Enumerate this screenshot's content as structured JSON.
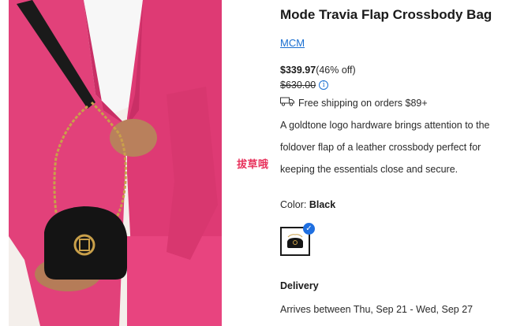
{
  "product": {
    "title": "Mode Travia Flap Crossbody Bag",
    "brand": "MCM",
    "sale_price": "$339.97",
    "discount": "(46% off)",
    "original_price": "$630.00",
    "shipping": "Free shipping on orders $89+",
    "description": "A goldtone logo hardware brings attention to the foldover flap of a leather crossbody perfect for keeping the essentials close and secure.",
    "image_alt": "Model in pink blazer and shorts wearing black crossbody bag with gold chain"
  },
  "color": {
    "label": "Color:",
    "selected": "Black",
    "swatches": [
      {
        "name": "Black",
        "selected": true
      }
    ]
  },
  "delivery": {
    "heading": "Delivery",
    "arrives": "Arrives between Thu, Sep 21 - Wed, Sep 27"
  },
  "annotation": "拔草哦",
  "icons": {
    "info": "info-icon",
    "truck": "truck-icon",
    "check": "check-icon"
  },
  "colors": {
    "blazer": "#e2417a",
    "link": "#1a6fd1",
    "check_badge": "#1f6fe0",
    "annotation": "#e8325c"
  }
}
